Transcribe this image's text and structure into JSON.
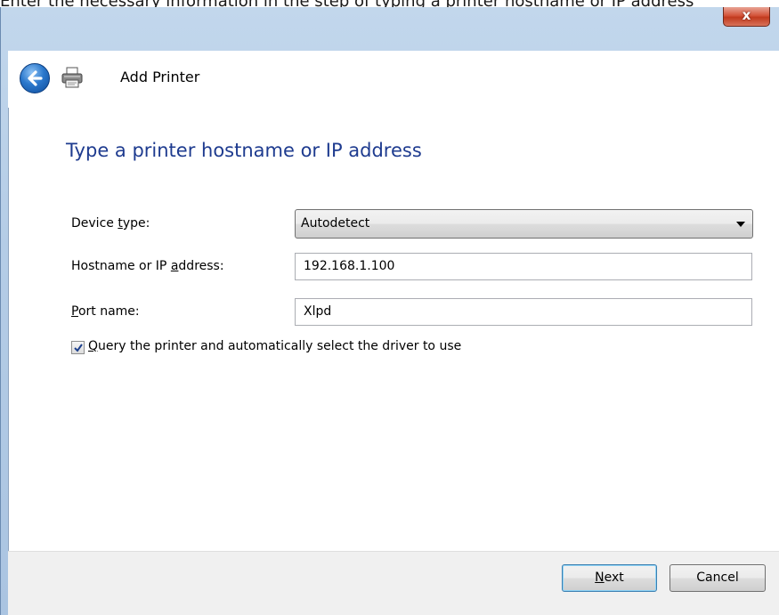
{
  "caption": "Enter the necessary information in the step of typing a printer hostname or IP address",
  "window": {
    "close_label": "x",
    "title": "Add Printer"
  },
  "icons": {
    "back": "back-arrow-icon",
    "printer": "printer-icon",
    "close": "close-icon",
    "dropdown": "chevron-down-icon",
    "check": "checkmark-icon"
  },
  "page": {
    "heading": "Type a printer hostname or IP address",
    "device_type": {
      "label_pre": "Device ",
      "label_key": "t",
      "label_post": "ype:",
      "value": "Autodetect"
    },
    "hostname": {
      "label_pre": "Hostname or IP ",
      "label_key": "a",
      "label_post": "ddress:",
      "value": "192.168.1.100"
    },
    "port": {
      "label_pre": "",
      "label_key": "P",
      "label_post": "ort name:",
      "value": "Xlpd"
    },
    "query_checkbox": {
      "checked": true,
      "label_key": "Q",
      "label_post": "uery the printer and automatically select the driver to use"
    }
  },
  "footer": {
    "next_key": "N",
    "next_post": "ext",
    "cancel_label": "Cancel"
  },
  "colors": {
    "heading": "#1e3b8f",
    "frame": "#b4cce6",
    "close": "#c13a1e"
  }
}
